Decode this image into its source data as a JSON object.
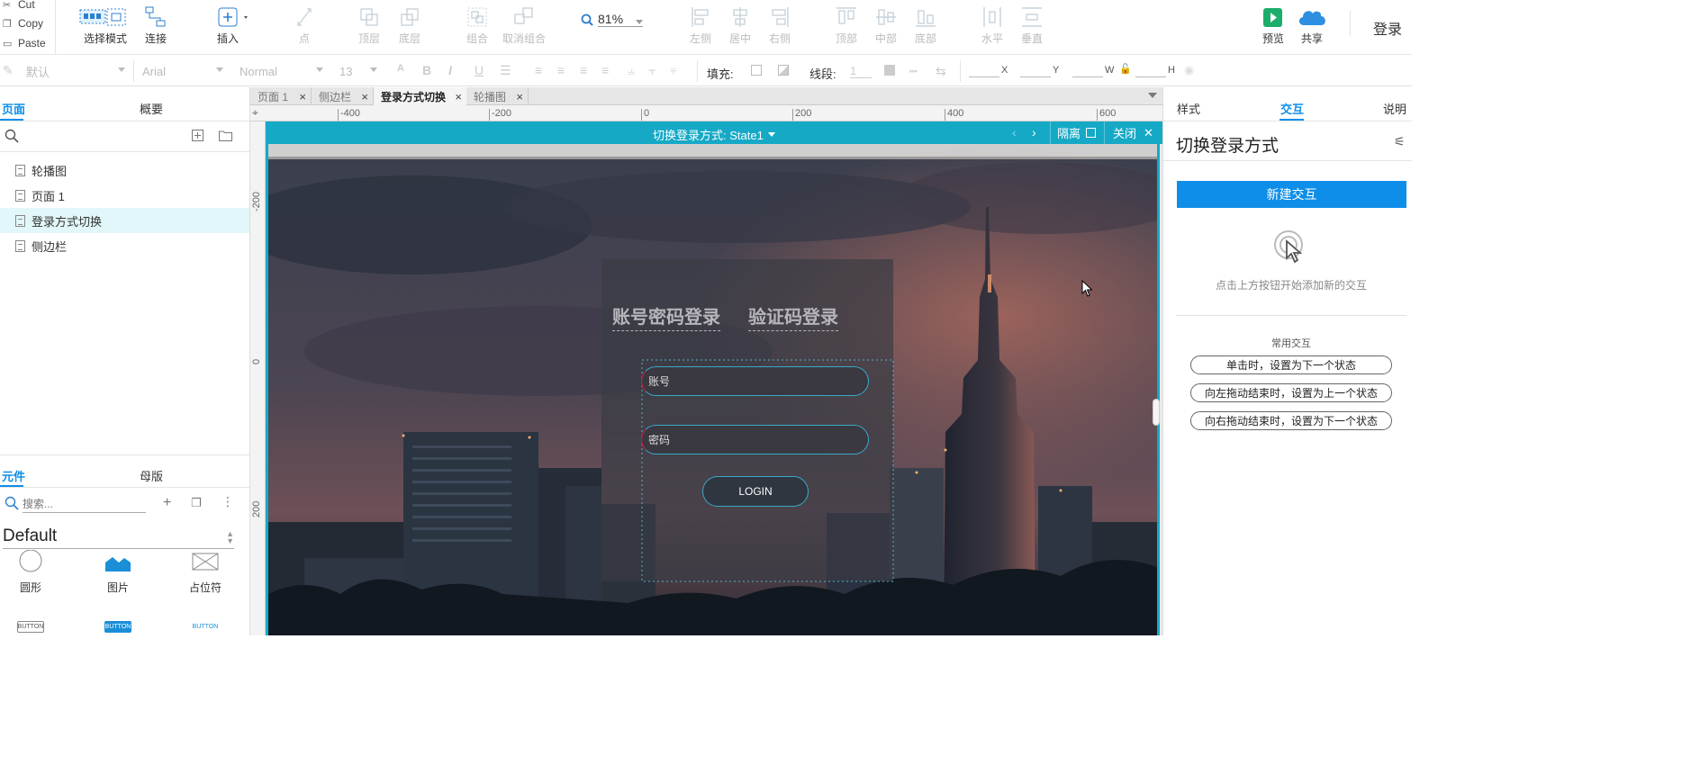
{
  "clipboard": {
    "cut": "Cut",
    "copy": "Copy",
    "paste": "Paste"
  },
  "toolbar": {
    "select_mode": "选择模式",
    "connect": "连接",
    "insert": "插入",
    "point": "点",
    "top_layer": "顶层",
    "bottom_layer": "底层",
    "group": "组合",
    "ungroup": "取消组合",
    "zoom": "81%",
    "align_left": "左侧",
    "align_center": "居中",
    "align_right": "右侧",
    "align_top": "顶部",
    "align_middle": "中部",
    "align_bottom": "底部",
    "distribute_h": "水平",
    "distribute_v": "垂直",
    "preview": "预览",
    "share": "共享",
    "login": "登录"
  },
  "format": {
    "style": "默认",
    "font": "Arial",
    "weight": "Normal",
    "size": "13",
    "fill_label": "填充:",
    "stroke_label": "线段:",
    "stroke_value": "1",
    "x_label": "X",
    "y_label": "Y",
    "w_label": "W",
    "h_label": "H"
  },
  "left_panel": {
    "tab_pages": "页面",
    "tab_outline": "概要",
    "pages": [
      "轮播图",
      "页面 1",
      "登录方式切换",
      "侧边栏"
    ],
    "selected_page": "登录方式切换",
    "tab_widgets": "元件",
    "tab_masters": "母版",
    "search_placeholder": "搜索...",
    "library": "Default",
    "widgets": [
      "圆形",
      "图片",
      "占位符"
    ],
    "button_samples": [
      "BUTTON",
      "BUTTON",
      "BUTTON"
    ]
  },
  "doc_tabs": [
    {
      "label": "页面 1",
      "active": false
    },
    {
      "label": "侧边栏",
      "active": false
    },
    {
      "label": "登录方式切换",
      "active": true
    },
    {
      "label": "轮播图",
      "active": false
    }
  ],
  "ruler": {
    "h_ticks": [
      "-400",
      "-200",
      "0",
      "200",
      "400",
      "600"
    ],
    "v_ticks": [
      "-200",
      "0",
      "200"
    ]
  },
  "dynamic_panel": {
    "title": "切换登录方式: State1",
    "isolate": "隔离",
    "close": "关闭"
  },
  "login_form": {
    "tab_password": "账号密码登录",
    "tab_code": "验证码登录",
    "account_placeholder": "账号",
    "password_placeholder": "密码",
    "login_button": "LOGIN"
  },
  "right_panel": {
    "tab_style": "样式",
    "tab_interaction": "交互",
    "tab_notes": "说明",
    "widget_name": "切换登录方式",
    "new_interaction": "新建交互",
    "hint": "点击上方按钮开始添加新的交互",
    "common_title": "常用交互",
    "common": [
      "单击时，设置为下一个状态",
      "向左拖动结束时，设置为上一个状态",
      "向右拖动结束时，设置为下一个状态"
    ]
  },
  "colors": {
    "accent": "#0e8ee9",
    "dynamic_bar": "#15a9c6",
    "selection": "#e2f7f9"
  }
}
